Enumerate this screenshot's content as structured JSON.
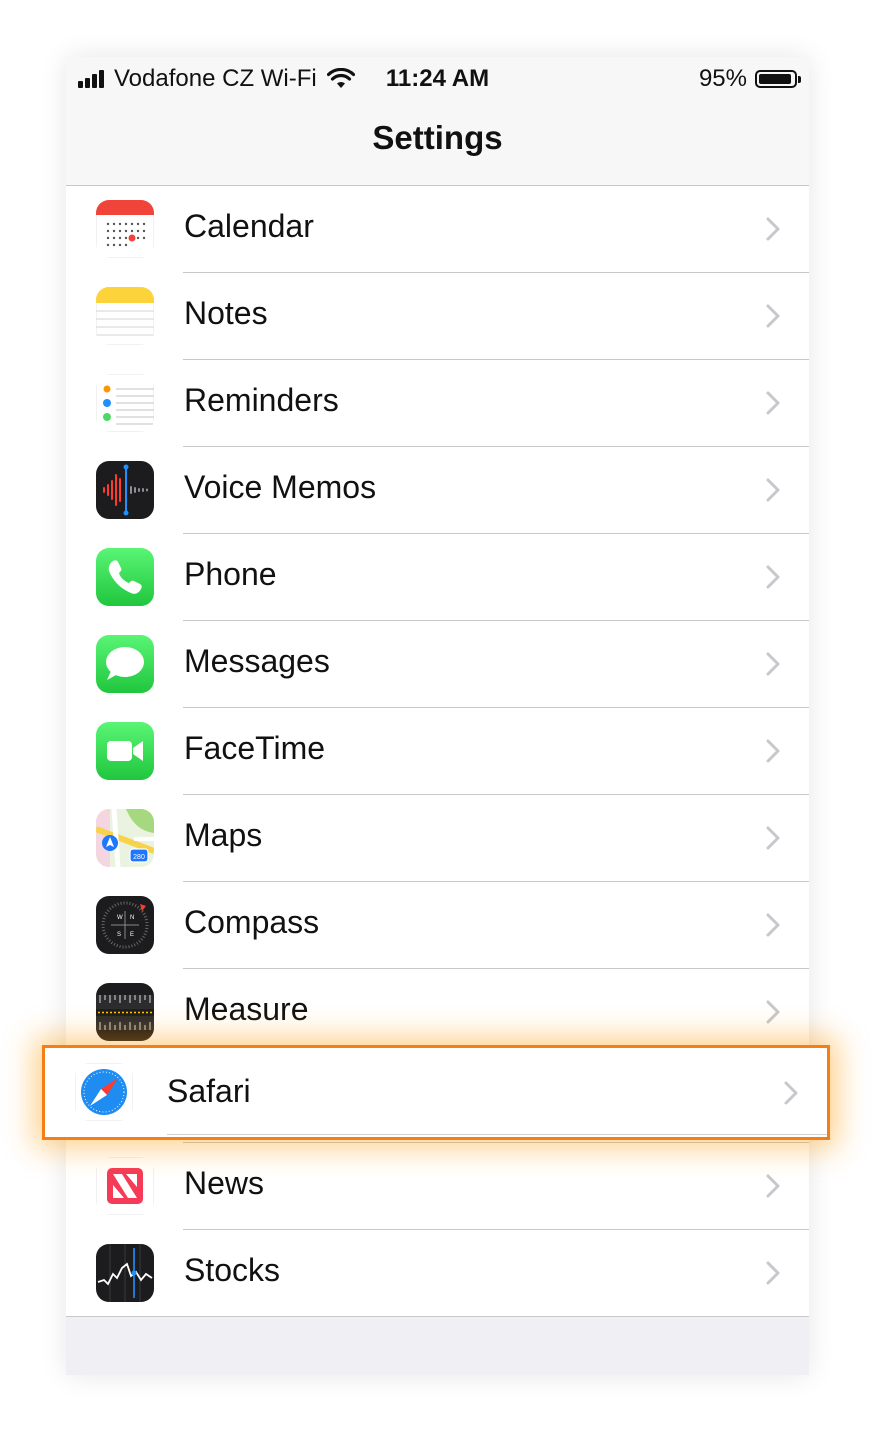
{
  "status_bar": {
    "carrier": "Vodafone CZ Wi-Fi",
    "time": "11:24 AM",
    "battery": "95%",
    "battery_level": 0.95,
    "signal_bars": 4,
    "wifi_icon": "wifi-icon"
  },
  "nav": {
    "title": "Settings"
  },
  "rows": [
    {
      "label": "Calendar",
      "icon": "calendar-app-icon"
    },
    {
      "label": "Notes",
      "icon": "notes-app-icon"
    },
    {
      "label": "Reminders",
      "icon": "reminders-app-icon"
    },
    {
      "label": "Voice Memos",
      "icon": "voice-memos-app-icon"
    },
    {
      "label": "Phone",
      "icon": "phone-app-icon"
    },
    {
      "label": "Messages",
      "icon": "messages-app-icon"
    },
    {
      "label": "FaceTime",
      "icon": "facetime-app-icon"
    },
    {
      "label": "Maps",
      "icon": "maps-app-icon"
    },
    {
      "label": "Compass",
      "icon": "compass-app-icon"
    },
    {
      "label": "Measure",
      "icon": "measure-app-icon"
    },
    {
      "label": "",
      "icon": "placeholder"
    },
    {
      "label": "News",
      "icon": "news-app-icon"
    },
    {
      "label": "Stocks",
      "icon": "stocks-app-icon"
    }
  ],
  "highlighted_row": {
    "label": "Safari",
    "icon": "safari-app-icon",
    "highlight_color": "#f57f17"
  },
  "colors": {
    "separator": "#c8c7cc",
    "chevron": "#c7c7cc",
    "background": "#efeff4"
  }
}
